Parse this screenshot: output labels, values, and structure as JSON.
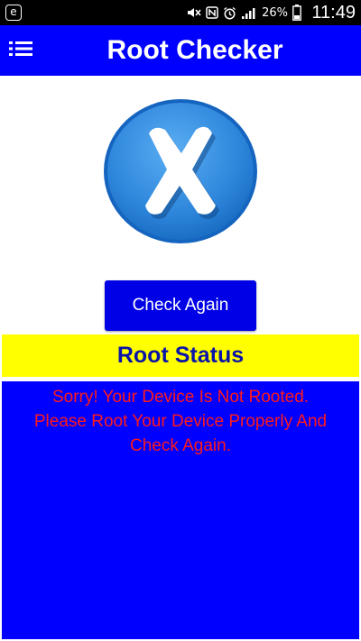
{
  "status_bar": {
    "notification_icon": "e",
    "battery_percent": "26%",
    "time": "11:49",
    "icons": [
      "mute-icon",
      "nfc-icon",
      "alarm-icon",
      "signal-icon",
      "battery-icon"
    ]
  },
  "app_bar": {
    "title": "Root Checker",
    "menu_icon": "list-menu-icon"
  },
  "status_badge": {
    "icon": "x-mark-icon",
    "state": "not-rooted"
  },
  "check_button": {
    "label": "Check Again"
  },
  "root_status": {
    "heading": "Root Status",
    "message_line1": "Sorry! Your Device Is Not Rooted.",
    "message_line2": "Please Root Your Device Properly And",
    "message_line3": "Check Again."
  },
  "colors": {
    "app_bar": "#0000ff",
    "header_bg": "#ffff00",
    "header_text": "#0a14a8",
    "panel_bg": "#0000ff",
    "message_text": "#ff1a1a",
    "badge_blue": "#3a8fe0"
  }
}
